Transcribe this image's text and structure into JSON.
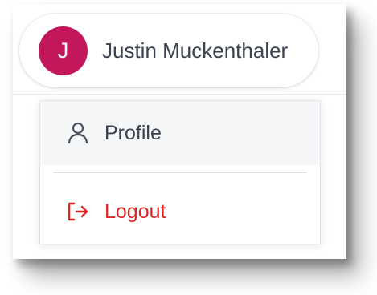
{
  "user": {
    "initial": "J",
    "name": "Justin Muckenthaler",
    "avatar_color": "#c2185b"
  },
  "menu": {
    "items": [
      {
        "label": "Profile",
        "icon": "user-icon",
        "color": "#3b4250"
      },
      {
        "label": "Logout",
        "icon": "logout-icon",
        "color": "#e02424"
      }
    ]
  }
}
